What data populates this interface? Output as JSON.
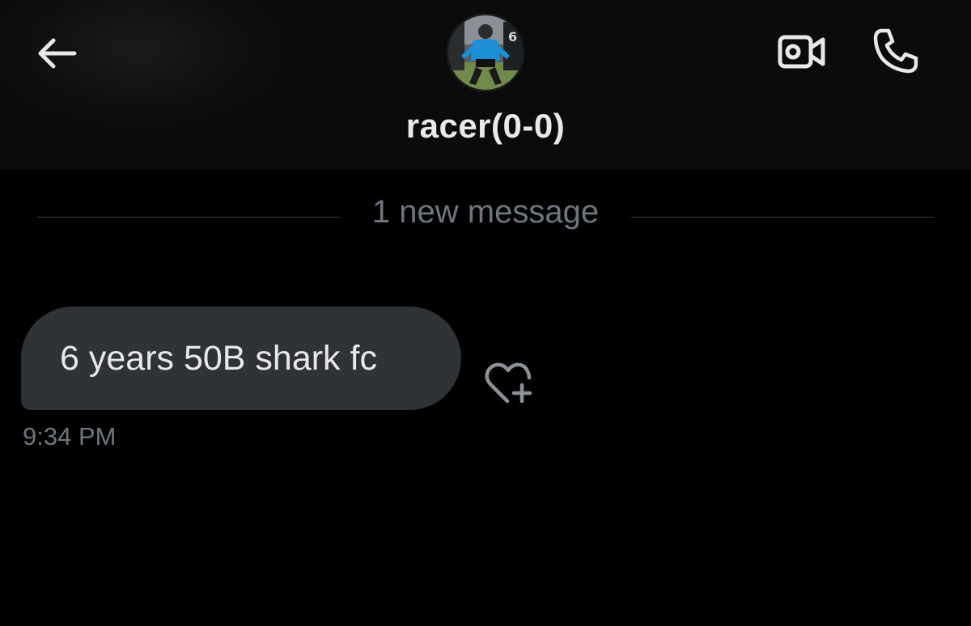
{
  "header": {
    "back_icon": "arrow-left-icon",
    "contact_name": "racer(0-0)",
    "video_icon": "video-camera-icon",
    "call_icon": "phone-icon"
  },
  "conversation": {
    "divider_text": "1 new message",
    "messages": [
      {
        "text": "6 years 50B shark fc",
        "time": "9:34 PM",
        "reaction_icon": "heart-plus-icon"
      }
    ]
  },
  "colors": {
    "background": "#000000",
    "header_background": "#0b0b0b",
    "bubble_background": "#2f3336",
    "primary_text": "#e7e9ea",
    "muted_text": "#6e767d",
    "divider": "#3a3d40"
  }
}
